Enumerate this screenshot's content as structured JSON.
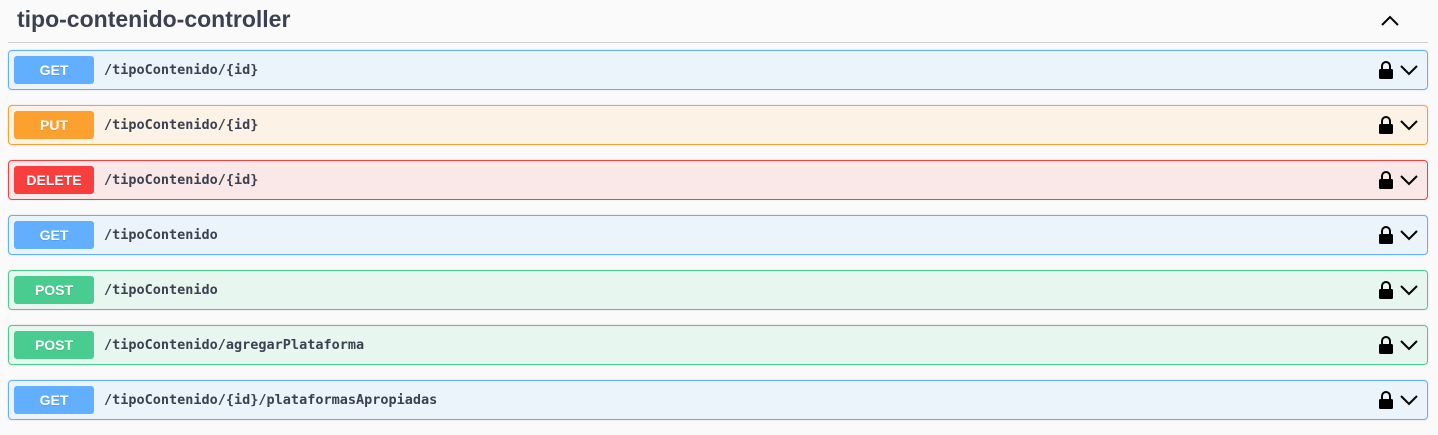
{
  "section": {
    "title": "tipo-contenido-controller",
    "collapse_icon": "chevron-up-icon"
  },
  "operations": [
    {
      "method": "GET",
      "path": "/tipoContenido/{id}",
      "color": "#61affe"
    },
    {
      "method": "PUT",
      "path": "/tipoContenido/{id}",
      "color": "#fca130"
    },
    {
      "method": "DELETE",
      "path": "/tipoContenido/{id}",
      "color": "#f93e3e"
    },
    {
      "method": "GET",
      "path": "/tipoContenido",
      "color": "#61affe"
    },
    {
      "method": "POST",
      "path": "/tipoContenido",
      "color": "#49cc90"
    },
    {
      "method": "POST",
      "path": "/tipoContenido/agregarPlataforma",
      "color": "#49cc90"
    },
    {
      "method": "GET",
      "path": "/tipoContenido/{id}/plataformasApropiadas",
      "color": "#61affe"
    }
  ],
  "icons": {
    "lock": "lock-icon",
    "expand": "chevron-down-icon"
  }
}
